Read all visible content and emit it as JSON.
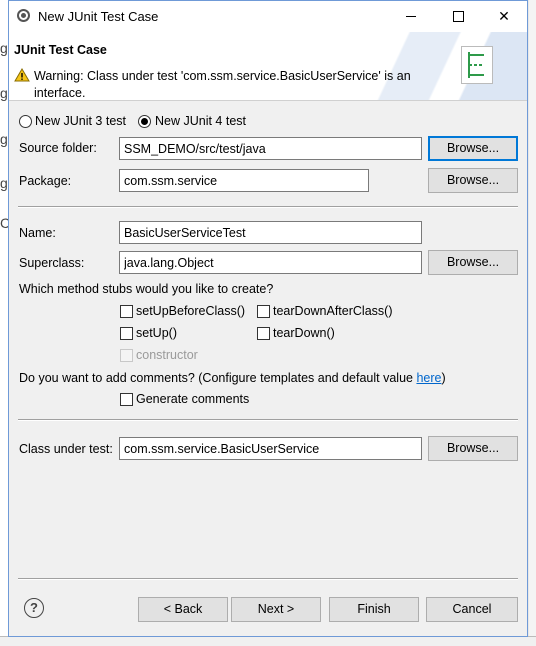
{
  "window": {
    "title": "New JUnit Test Case",
    "minimize": "",
    "maximize": "",
    "close": "✕"
  },
  "header": {
    "title": "JUnit Test Case",
    "warning": "Warning: Class under test 'com.ssm.service.BasicUserService' is an interface."
  },
  "version": {
    "junit3_label": "New JUnit 3 test",
    "junit4_label": "New JUnit 4 test",
    "junit3_selected": false,
    "junit4_selected": true
  },
  "form": {
    "source_folder_label": "Source folder:",
    "source_folder_value": "SSM_DEMO/src/test/java",
    "package_label": "Package:",
    "package_value": "com.ssm.service",
    "name_label": "Name:",
    "name_value": "BasicUserServiceTest",
    "superclass_label": "Superclass:",
    "superclass_value": "java.lang.Object",
    "browse_label": "Browse...",
    "stubs_question": "Which method stubs would you like to create?",
    "stubs": {
      "setup_before_class": "setUpBeforeClass()",
      "teardown_after_class": "tearDownAfterClass()",
      "setup": "setUp()",
      "teardown": "tearDown()",
      "constructor": "constructor"
    },
    "comments_question": "Do you want to add comments? (Configure templates and default value ",
    "comments_link": "here",
    "comments_close": ")",
    "generate_comments": "Generate comments",
    "class_under_test_label": "Class under test:",
    "class_under_test_value": "com.ssm.service.BasicUserService"
  },
  "footer": {
    "help": "?",
    "back": "< Back",
    "next": "Next >",
    "finish": "Finish",
    "cancel": "Cancel"
  },
  "background": {
    "left_letters": [
      "g",
      "g",
      "g",
      "g",
      "C"
    ]
  },
  "colors": {
    "link": "#0066cc",
    "default_button_border": "#0078d7",
    "window_border": "#6f9ad7"
  }
}
